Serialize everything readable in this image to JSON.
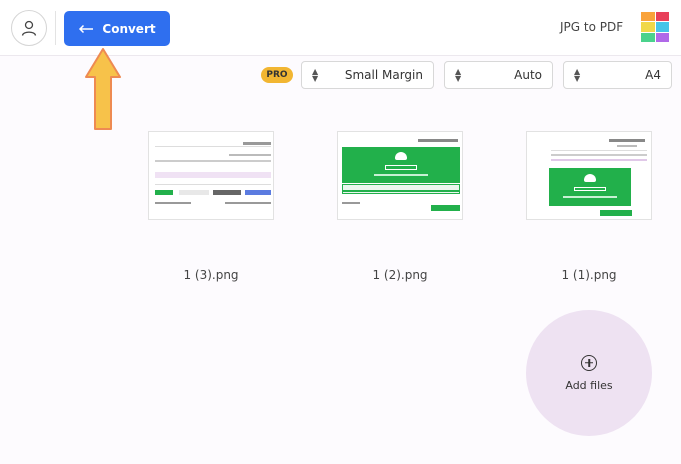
{
  "header": {
    "convert_label": "Convert",
    "app_title": "JPG to PDF",
    "logo_colors": [
      "#f9a33b",
      "#e8405a",
      "#46c4e8",
      "#4ad28c",
      "#b069e8",
      "#f0d84a"
    ]
  },
  "toolbar": {
    "pro_badge": "PRO",
    "margin_value": "Small Margin",
    "orientation_value": "Auto",
    "page_size_value": "A4"
  },
  "files": [
    {
      "name": "1 (3).png"
    },
    {
      "name": "1 (2).png"
    },
    {
      "name": "1 (1).png"
    }
  ],
  "add_files_label": "Add files",
  "colors": {
    "accent": "#2f6fef",
    "pro": "#f2b632",
    "add_bg": "#eee2f2",
    "thumb_green": "#22b04b",
    "annotation_arrow": "#f7c24a"
  }
}
